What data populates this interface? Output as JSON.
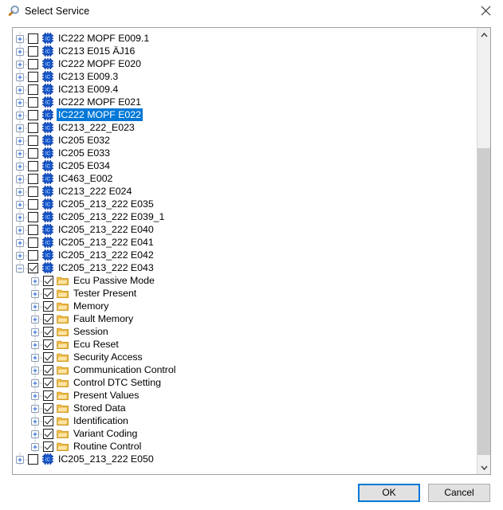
{
  "window": {
    "title": "Select Service",
    "icon": "magnifier-icon",
    "close_label": "✕"
  },
  "colors": {
    "selection_blue": "#0078d7",
    "chip_icon_blue": "#1558cc",
    "folder_yellow": "#f8c44f",
    "scrollbar_track": "#f0f0f0",
    "scrollbar_thumb": "#cdcdcd",
    "panel_border": "#a0a0a0",
    "button_face": "#e1e1e1"
  },
  "tree": {
    "items": [
      {
        "label": "IC222 MOPF E009.1",
        "icon": "chip-icon",
        "level": 0,
        "expander": "plus",
        "checked": false,
        "selected": false
      },
      {
        "label": "IC213 E015 ÄJ16",
        "icon": "chip-icon",
        "level": 0,
        "expander": "plus",
        "checked": false,
        "selected": false
      },
      {
        "label": "IC222 MOPF E020",
        "icon": "chip-icon",
        "level": 0,
        "expander": "plus",
        "checked": false,
        "selected": false
      },
      {
        "label": "IC213 E009.3",
        "icon": "chip-icon",
        "level": 0,
        "expander": "plus",
        "checked": false,
        "selected": false
      },
      {
        "label": "IC213 E009.4",
        "icon": "chip-icon",
        "level": 0,
        "expander": "plus",
        "checked": false,
        "selected": false
      },
      {
        "label": "IC222 MOPF E021",
        "icon": "chip-icon",
        "level": 0,
        "expander": "plus",
        "checked": false,
        "selected": false
      },
      {
        "label": "IC222 MOPF E022",
        "icon": "chip-icon",
        "level": 0,
        "expander": "plus",
        "checked": false,
        "selected": true
      },
      {
        "label": "IC213_222_E023",
        "icon": "chip-icon",
        "level": 0,
        "expander": "plus",
        "checked": false,
        "selected": false
      },
      {
        "label": "IC205 E032",
        "icon": "chip-icon",
        "level": 0,
        "expander": "plus",
        "checked": false,
        "selected": false
      },
      {
        "label": "IC205 E033",
        "icon": "chip-icon",
        "level": 0,
        "expander": "plus",
        "checked": false,
        "selected": false
      },
      {
        "label": "IC205 E034",
        "icon": "chip-icon",
        "level": 0,
        "expander": "plus",
        "checked": false,
        "selected": false
      },
      {
        "label": "IC463_E002",
        "icon": "chip-icon",
        "level": 0,
        "expander": "plus",
        "checked": false,
        "selected": false
      },
      {
        "label": "IC213_222 E024",
        "icon": "chip-icon",
        "level": 0,
        "expander": "plus",
        "checked": false,
        "selected": false
      },
      {
        "label": "IC205_213_222 E035",
        "icon": "chip-icon",
        "level": 0,
        "expander": "plus",
        "checked": false,
        "selected": false
      },
      {
        "label": "IC205_213_222 E039_1",
        "icon": "chip-icon",
        "level": 0,
        "expander": "plus",
        "checked": false,
        "selected": false
      },
      {
        "label": "IC205_213_222 E040",
        "icon": "chip-icon",
        "level": 0,
        "expander": "plus",
        "checked": false,
        "selected": false
      },
      {
        "label": "IC205_213_222 E041",
        "icon": "chip-icon",
        "level": 0,
        "expander": "plus",
        "checked": false,
        "selected": false
      },
      {
        "label": "IC205_213_222 E042",
        "icon": "chip-icon",
        "level": 0,
        "expander": "plus",
        "checked": false,
        "selected": false
      },
      {
        "label": "IC205_213_222 E043",
        "icon": "chip-icon",
        "level": 0,
        "expander": "minus",
        "checked": true,
        "selected": false
      },
      {
        "label": "Ecu Passive Mode",
        "icon": "folder-icon",
        "level": 1,
        "expander": "plus",
        "checked": true,
        "selected": false
      },
      {
        "label": "Tester Present",
        "icon": "folder-icon",
        "level": 1,
        "expander": "plus",
        "checked": true,
        "selected": false
      },
      {
        "label": "Memory",
        "icon": "folder-icon",
        "level": 1,
        "expander": "plus",
        "checked": true,
        "selected": false
      },
      {
        "label": "Fault Memory",
        "icon": "folder-icon",
        "level": 1,
        "expander": "plus",
        "checked": true,
        "selected": false
      },
      {
        "label": "Session",
        "icon": "folder-icon",
        "level": 1,
        "expander": "plus",
        "checked": true,
        "selected": false
      },
      {
        "label": "Ecu Reset",
        "icon": "folder-icon",
        "level": 1,
        "expander": "plus",
        "checked": true,
        "selected": false
      },
      {
        "label": "Security Access",
        "icon": "folder-icon",
        "level": 1,
        "expander": "plus",
        "checked": true,
        "selected": false
      },
      {
        "label": "Communication Control",
        "icon": "folder-icon",
        "level": 1,
        "expander": "plus",
        "checked": true,
        "selected": false
      },
      {
        "label": "Control DTC Setting",
        "icon": "folder-icon",
        "level": 1,
        "expander": "plus",
        "checked": true,
        "selected": false
      },
      {
        "label": "Present Values",
        "icon": "folder-icon",
        "level": 1,
        "expander": "plus",
        "checked": true,
        "selected": false
      },
      {
        "label": "Stored Data",
        "icon": "folder-icon",
        "level": 1,
        "expander": "plus",
        "checked": true,
        "selected": false
      },
      {
        "label": "Identification",
        "icon": "folder-icon",
        "level": 1,
        "expander": "plus",
        "checked": true,
        "selected": false
      },
      {
        "label": "Variant Coding",
        "icon": "folder-icon",
        "level": 1,
        "expander": "plus",
        "checked": true,
        "selected": false
      },
      {
        "label": "Routine Control",
        "icon": "folder-icon",
        "level": 1,
        "expander": "plus",
        "checked": true,
        "selected": false
      },
      {
        "label": "IC205_213_222 E050",
        "icon": "chip-icon",
        "level": 0,
        "expander": "plus",
        "checked": false,
        "selected": false
      }
    ]
  },
  "scrollbar": {
    "up_arrow": "chevron-up-icon",
    "down_arrow": "chevron-down-icon"
  },
  "footer": {
    "ok_label": "OK",
    "cancel_label": "Cancel"
  }
}
